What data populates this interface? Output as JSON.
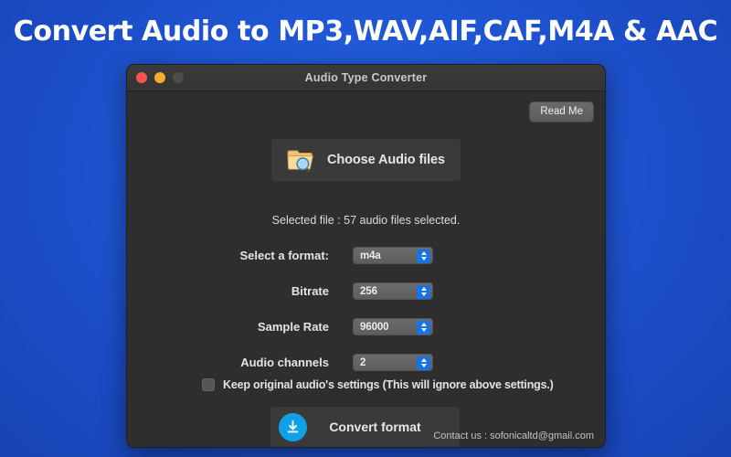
{
  "banner": {
    "headline": "Convert Audio to MP3,WAV,AIF,CAF,M4A & AAC",
    "background_color": "#1f56d4",
    "text_color": "#ffffff"
  },
  "window": {
    "title": "Audio Type Converter",
    "background_color": "#2e2e2e",
    "traffic_lights": [
      {
        "name": "close",
        "color": "#f5564c"
      },
      {
        "name": "minimize",
        "color": "#f6ae2f"
      },
      {
        "name": "zoom",
        "color": "#4e4e4e"
      }
    ]
  },
  "toolbar": {
    "read_me_label": "Read Me"
  },
  "chooser": {
    "label": "Choose Audio files",
    "icon": "folder-search-icon"
  },
  "status": {
    "selected_file_text": "Selected file : 57 audio files selected."
  },
  "settings": {
    "rows": [
      {
        "label": "Select a format:",
        "value": "m4a",
        "name": "format"
      },
      {
        "label": "Bitrate",
        "value": "256",
        "name": "bitrate"
      },
      {
        "label": "Sample Rate",
        "value": "96000",
        "name": "sample-rate"
      },
      {
        "label": "Audio channels",
        "value": "2",
        "name": "audio-channels"
      }
    ],
    "keep_original": {
      "label": "Keep original audio's settings (This will ignore above settings.)",
      "checked": false
    }
  },
  "convert": {
    "label": "Convert format",
    "icon": "download-icon",
    "accent_color": "#10a0e8"
  },
  "footer": {
    "contact_text": "Contact us : sofonicaltd@gmail.com"
  }
}
